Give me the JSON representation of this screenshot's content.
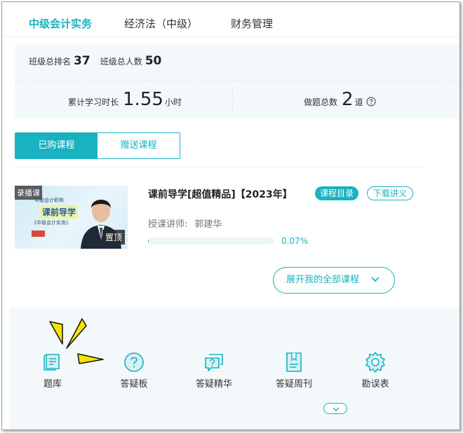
{
  "subject_tabs": [
    {
      "label": "中级会计实务",
      "active": true
    },
    {
      "label": "经济法（中级）",
      "active": false
    },
    {
      "label": "财务管理",
      "active": false
    }
  ],
  "stats": {
    "rank_label": "班级总排名",
    "rank_value": "37",
    "total_label": "班级总人数",
    "total_value": "50",
    "study_label": "累计学习时长",
    "study_value": "1.55",
    "study_unit": "小时",
    "questions_label": "做题总数",
    "questions_value": "2",
    "questions_unit": "道"
  },
  "course_tabs": [
    {
      "label": "已购课程",
      "active": true
    },
    {
      "label": "赠送课程",
      "active": false
    }
  ],
  "course": {
    "badge": "录播课",
    "thumb_small": "中级会计职称",
    "thumb_title": "课前导学",
    "thumb_sub": "《中级会计实务》",
    "pin": "置顶",
    "title": "课前导学[超值精品]【2023年】",
    "catalog_label": "课程目录",
    "notes_label": "下载讲义",
    "teacher_label": "授课讲师:",
    "teacher_name": "郭建华",
    "progress_text": "0.07%",
    "progress_fraction": 0.0007
  },
  "expand_label": "展开我的全部课程",
  "tools": [
    {
      "label": "题库",
      "icon": "question-bank-icon"
    },
    {
      "label": "答疑板",
      "icon": "qa-board-icon"
    },
    {
      "label": "答疑精华",
      "icon": "qa-highlight-icon"
    },
    {
      "label": "答疑周刊",
      "icon": "qa-weekly-icon"
    },
    {
      "label": "勘误表",
      "icon": "errata-gear-icon"
    }
  ],
  "colors": {
    "accent": "#18b2c1",
    "panel_bg": "#f3f9fb",
    "sparkle": "#f5e400"
  }
}
